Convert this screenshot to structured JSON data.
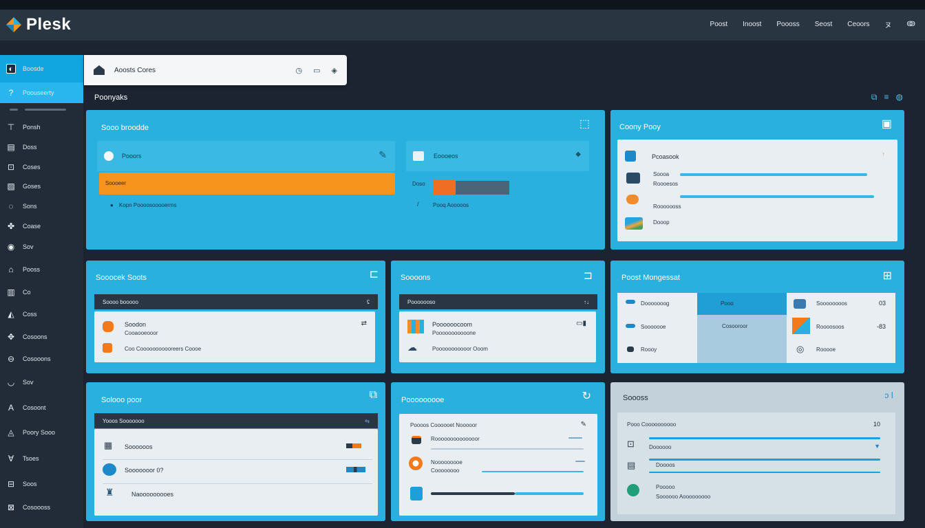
{
  "app": {
    "name": "Plesk"
  },
  "header": {
    "nav": [
      "Poost",
      "Inoost",
      "Poooss",
      "Seost",
      "Ceoors",
      "ヌ",
      "ↂ"
    ]
  },
  "sidebar": {
    "top_label": "Boosde",
    "selected_label": "Poouseerty",
    "items": [
      {
        "icon": "⊤",
        "label": "Ponsh"
      },
      {
        "icon": "▤",
        "label": "Doss"
      },
      {
        "icon": "⊡",
        "label": "Coses"
      },
      {
        "icon": "▨",
        "label": "Goses"
      },
      {
        "icon": "◌",
        "label": "Sons"
      },
      {
        "icon": "✤",
        "label": "Coase"
      },
      {
        "icon": "◉",
        "label": "Sov"
      },
      {
        "icon": "⌂",
        "label": "Pooss"
      },
      {
        "icon": "▥",
        "label": "Co"
      },
      {
        "icon": "◭",
        "label": "Coss"
      },
      {
        "icon": "✥",
        "label": "Cosoons"
      },
      {
        "icon": "⊖",
        "label": "Cosooons"
      },
      {
        "icon": "◡",
        "label": "Sov"
      },
      {
        "icon": "A",
        "label": "Cosoont"
      },
      {
        "icon": "◬",
        "label": "Poory Sooo"
      },
      {
        "icon": "∀",
        "label": "Tsoes"
      },
      {
        "icon": "⊟",
        "label": "Soos"
      },
      {
        "icon": "⊠",
        "label": "Cosoooss"
      }
    ]
  },
  "search": {
    "label": "Aoosts Cores"
  },
  "section_title": "Poonyaks",
  "panel1": {
    "title": "Sooo broodde",
    "left": {
      "label": "Pooors",
      "orange": "Soooeer",
      "note": "Kopn Poooosooooerms"
    },
    "right": {
      "label": "Eoooeos",
      "small": "Doso",
      "note": "Pooq Aooooos"
    }
  },
  "panel2": {
    "title": "Coony Pooy",
    "items": [
      {
        "label": "Pcoasook",
        "sub": "Soooa"
      },
      {
        "label": "Roooesos"
      },
      {
        "label": "Rooooooss"
      },
      {
        "label": "Dooop"
      }
    ]
  },
  "panel3": {
    "title": "Sooocek Soots",
    "bar": "Soooo booooo",
    "rows": [
      {
        "title": "Soodon",
        "sub": "Cooaooeooor"
      },
      {
        "title": "Coo Cooooooooooreers Coooe"
      }
    ]
  },
  "panel4": {
    "title": "Soooons",
    "bar": "Pooooooso",
    "rows": [
      {
        "title": "Poooooocoom",
        "sub": "Pooooooooooone"
      },
      {
        "title": "Pooooooooooor Ooom"
      }
    ]
  },
  "panel5": {
    "title": "Poost Mongessat",
    "rows": [
      {
        "left": "Dooooooog",
        "mid": "Pooo",
        "right": "Soooooooos",
        "value": "03"
      },
      {
        "left": "Sooooooe",
        "mid": "Cosooroor",
        "right": "Roooosoos",
        "value": "-83"
      },
      {
        "left": "Roooy",
        "right": "Rooooe"
      }
    ]
  },
  "panel6": {
    "title": "Solooo poor",
    "bar": "Yooos Sooooooo",
    "rows": [
      {
        "label": "Soooooos"
      },
      {
        "label": "Sooooooor 0?"
      },
      {
        "label": "Naooooooooes"
      }
    ]
  },
  "panel7": {
    "title": "Pooooooooe",
    "card_title": "Poooos Coooooet Nooooor",
    "rows": [
      {
        "label": "Roooooooooooooor"
      },
      {
        "label": "Nooooooooe",
        "sub": "Coooooooo"
      }
    ]
  },
  "panel8": {
    "title": "Soooss",
    "card_title": "Pooo Coooooooooo",
    "rows": [
      {
        "label": "Doooooo"
      },
      {
        "label": "Doooos"
      },
      {
        "label": "Pooooo",
        "sub": "Soooooo Aooooooooo"
      }
    ]
  },
  "colors": {
    "accent": "#2ab0de",
    "sidebar_active": "#12a6e0",
    "orange": "#f7941d",
    "header": "#2a3542"
  }
}
